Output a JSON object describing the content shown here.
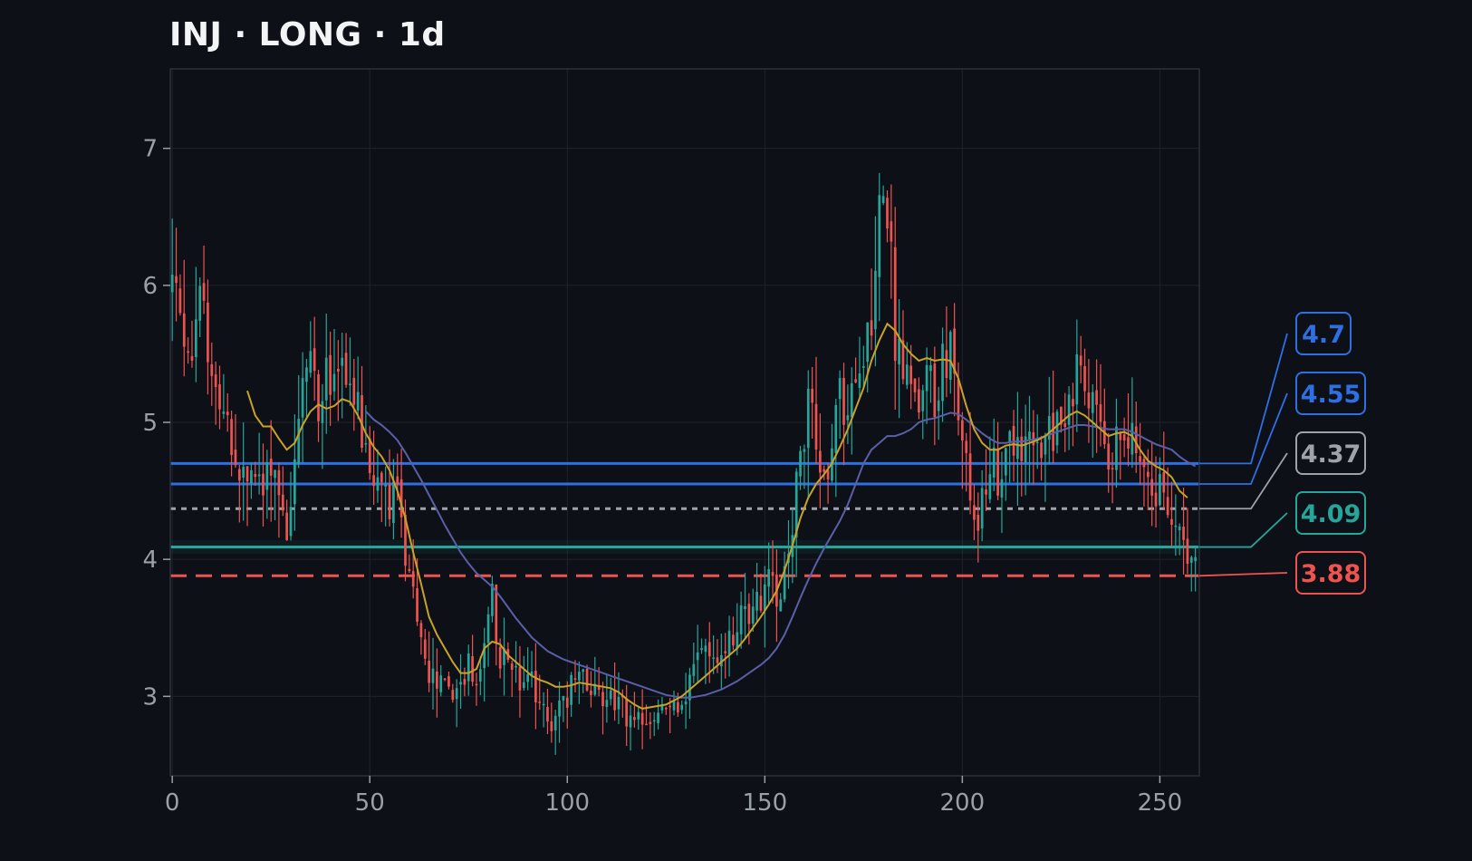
{
  "title": "INJ · LONG · 1d",
  "colors": {
    "background": "#0d1017",
    "plot_border": "#2c313a",
    "grid": "#1e232b",
    "tick_text": "#9aa0a8",
    "bull": "#26a69a",
    "bear": "#ef5350",
    "ma_fast": "#c9a227",
    "ma_slow": "#5a5fa8"
  },
  "chart_data": {
    "type": "candlestick",
    "title": "INJ · LONG · 1d",
    "xlabel": "",
    "ylabel": "",
    "xlim": [
      -0.5,
      260
    ],
    "ylim": [
      2.42,
      7.58
    ],
    "x_ticks": [
      0,
      50,
      100,
      150,
      200,
      250
    ],
    "y_ticks": [
      3,
      4,
      5,
      6,
      7
    ],
    "grid": true,
    "anchors": [
      [
        0,
        6.0
      ],
      [
        3,
        5.7
      ],
      [
        5,
        5.5
      ],
      [
        7,
        5.8
      ],
      [
        9,
        5.6
      ],
      [
        11,
        5.3
      ],
      [
        13,
        5.0
      ],
      [
        15,
        4.8
      ],
      [
        17,
        4.65
      ],
      [
        19,
        4.55
      ],
      [
        21,
        4.6
      ],
      [
        23,
        4.5
      ],
      [
        25,
        4.75
      ],
      [
        27,
        4.55
      ],
      [
        29,
        4.2
      ],
      [
        31,
        4.75
      ],
      [
        33,
        5.25
      ],
      [
        35,
        5.5
      ],
      [
        37,
        5.15
      ],
      [
        39,
        5.35
      ],
      [
        41,
        5.2
      ],
      [
        43,
        5.55
      ],
      [
        45,
        5.15
      ],
      [
        47,
        5.05
      ],
      [
        49,
        4.7
      ],
      [
        51,
        4.55
      ],
      [
        53,
        4.6
      ],
      [
        55,
        4.4
      ],
      [
        57,
        4.5
      ],
      [
        59,
        4.0
      ],
      [
        61,
        3.7
      ],
      [
        63,
        3.5
      ],
      [
        65,
        3.15
      ],
      [
        67,
        3.1
      ],
      [
        69,
        3.05
      ],
      [
        71,
        2.98
      ],
      [
        73,
        3.15
      ],
      [
        75,
        3.2
      ],
      [
        77,
        3.05
      ],
      [
        79,
        3.4
      ],
      [
        81,
        3.7
      ],
      [
        83,
        3.3
      ],
      [
        85,
        3.2
      ],
      [
        87,
        3.15
      ],
      [
        89,
        3.05
      ],
      [
        91,
        3.1
      ],
      [
        93,
        2.9
      ],
      [
        95,
        2.82
      ],
      [
        97,
        2.85
      ],
      [
        99,
        2.95
      ],
      [
        101,
        3.05
      ],
      [
        103,
        3.15
      ],
      [
        105,
        3.1
      ],
      [
        107,
        3.05
      ],
      [
        109,
        3.0
      ],
      [
        111,
        3.05
      ],
      [
        113,
        2.95
      ],
      [
        115,
        2.85
      ],
      [
        117,
        2.8
      ],
      [
        119,
        2.78
      ],
      [
        121,
        2.82
      ],
      [
        123,
        2.88
      ],
      [
        125,
        2.92
      ],
      [
        127,
        2.96
      ],
      [
        129,
        2.95
      ],
      [
        131,
        3.1
      ],
      [
        133,
        3.35
      ],
      [
        135,
        3.3
      ],
      [
        137,
        3.25
      ],
      [
        139,
        3.35
      ],
      [
        141,
        3.4
      ],
      [
        143,
        3.55
      ],
      [
        145,
        3.7
      ],
      [
        147,
        3.6
      ],
      [
        149,
        3.7
      ],
      [
        151,
        3.85
      ],
      [
        153,
        3.75
      ],
      [
        155,
        3.9
      ],
      [
        157,
        4.3
      ],
      [
        159,
        4.8
      ],
      [
        161,
        5.1
      ],
      [
        163,
        4.85
      ],
      [
        165,
        4.6
      ],
      [
        167,
        4.75
      ],
      [
        169,
        5.2
      ],
      [
        171,
        5.0
      ],
      [
        173,
        5.3
      ],
      [
        175,
        5.6
      ],
      [
        177,
        5.8
      ],
      [
        179,
        6.7
      ],
      [
        181,
        6.6
      ],
      [
        183,
        5.6
      ],
      [
        185,
        5.3
      ],
      [
        187,
        5.4
      ],
      [
        189,
        5.1
      ],
      [
        191,
        5.3
      ],
      [
        193,
        5.2
      ],
      [
        195,
        5.45
      ],
      [
        197,
        5.5
      ],
      [
        199,
        5.1
      ],
      [
        201,
        4.8
      ],
      [
        203,
        4.2
      ],
      [
        205,
        4.5
      ],
      [
        207,
        4.75
      ],
      [
        209,
        4.55
      ],
      [
        211,
        4.85
      ],
      [
        213,
        4.8
      ],
      [
        215,
        4.7
      ],
      [
        217,
        4.9
      ],
      [
        219,
        4.75
      ],
      [
        221,
        5.0
      ],
      [
        223,
        4.95
      ],
      [
        225,
        5.1
      ],
      [
        227,
        5.2
      ],
      [
        229,
        5.35
      ],
      [
        231,
        5.2
      ],
      [
        233,
        5.05
      ],
      [
        235,
        4.9
      ],
      [
        237,
        4.6
      ],
      [
        239,
        4.9
      ],
      [
        241,
        5.0
      ],
      [
        243,
        4.95
      ],
      [
        245,
        4.7
      ],
      [
        247,
        4.55
      ],
      [
        249,
        4.35
      ],
      [
        251,
        4.65
      ],
      [
        253,
        4.3
      ],
      [
        255,
        4.1
      ],
      [
        257,
        4.05
      ],
      [
        259,
        4.15
      ]
    ],
    "ma_fast": [
      [
        19,
        5.23
      ],
      [
        21,
        5.05
      ],
      [
        23,
        4.97
      ],
      [
        25,
        4.97
      ],
      [
        27,
        4.88
      ],
      [
        29,
        4.8
      ],
      [
        31,
        4.85
      ],
      [
        33,
        4.98
      ],
      [
        35,
        5.08
      ],
      [
        37,
        5.13
      ],
      [
        39,
        5.1
      ],
      [
        41,
        5.12
      ],
      [
        43,
        5.17
      ],
      [
        45,
        5.15
      ],
      [
        47,
        5.05
      ],
      [
        49,
        4.92
      ],
      [
        51,
        4.82
      ],
      [
        53,
        4.75
      ],
      [
        55,
        4.65
      ],
      [
        57,
        4.5
      ],
      [
        59,
        4.3
      ],
      [
        61,
        4.05
      ],
      [
        63,
        3.82
      ],
      [
        65,
        3.58
      ],
      [
        67,
        3.45
      ],
      [
        69,
        3.35
      ],
      [
        71,
        3.25
      ],
      [
        73,
        3.17
      ],
      [
        75,
        3.17
      ],
      [
        77,
        3.2
      ],
      [
        79,
        3.35
      ],
      [
        81,
        3.4
      ],
      [
        83,
        3.38
      ],
      [
        85,
        3.3
      ],
      [
        87,
        3.25
      ],
      [
        89,
        3.2
      ],
      [
        91,
        3.15
      ],
      [
        93,
        3.12
      ],
      [
        95,
        3.1
      ],
      [
        97,
        3.07
      ],
      [
        99,
        3.07
      ],
      [
        101,
        3.08
      ],
      [
        103,
        3.1
      ],
      [
        105,
        3.09
      ],
      [
        107,
        3.08
      ],
      [
        109,
        3.07
      ],
      [
        111,
        3.06
      ],
      [
        113,
        3.03
      ],
      [
        115,
        2.98
      ],
      [
        117,
        2.94
      ],
      [
        119,
        2.91
      ],
      [
        121,
        2.92
      ],
      [
        123,
        2.93
      ],
      [
        125,
        2.94
      ],
      [
        127,
        2.97
      ],
      [
        129,
        3.0
      ],
      [
        131,
        3.05
      ],
      [
        133,
        3.1
      ],
      [
        135,
        3.15
      ],
      [
        137,
        3.2
      ],
      [
        139,
        3.25
      ],
      [
        141,
        3.3
      ],
      [
        143,
        3.35
      ],
      [
        145,
        3.42
      ],
      [
        147,
        3.5
      ],
      [
        149,
        3.58
      ],
      [
        151,
        3.67
      ],
      [
        153,
        3.77
      ],
      [
        155,
        3.92
      ],
      [
        157,
        4.1
      ],
      [
        159,
        4.3
      ],
      [
        161,
        4.45
      ],
      [
        163,
        4.55
      ],
      [
        165,
        4.62
      ],
      [
        167,
        4.7
      ],
      [
        169,
        4.82
      ],
      [
        171,
        4.95
      ],
      [
        173,
        5.1
      ],
      [
        175,
        5.25
      ],
      [
        177,
        5.45
      ],
      [
        179,
        5.6
      ],
      [
        181,
        5.72
      ],
      [
        183,
        5.67
      ],
      [
        185,
        5.57
      ],
      [
        187,
        5.5
      ],
      [
        189,
        5.45
      ],
      [
        191,
        5.47
      ],
      [
        193,
        5.45
      ],
      [
        195,
        5.46
      ],
      [
        197,
        5.45
      ],
      [
        199,
        5.32
      ],
      [
        201,
        5.12
      ],
      [
        203,
        4.95
      ],
      [
        205,
        4.85
      ],
      [
        207,
        4.8
      ],
      [
        209,
        4.8
      ],
      [
        211,
        4.83
      ],
      [
        213,
        4.84
      ],
      [
        215,
        4.83
      ],
      [
        217,
        4.85
      ],
      [
        219,
        4.87
      ],
      [
        221,
        4.9
      ],
      [
        223,
        4.95
      ],
      [
        225,
        5.0
      ],
      [
        227,
        5.05
      ],
      [
        229,
        5.08
      ],
      [
        231,
        5.05
      ],
      [
        233,
        5.0
      ],
      [
        235,
        4.95
      ],
      [
        237,
        4.9
      ],
      [
        239,
        4.92
      ],
      [
        241,
        4.93
      ],
      [
        243,
        4.9
      ],
      [
        245,
        4.8
      ],
      [
        247,
        4.72
      ],
      [
        249,
        4.68
      ],
      [
        251,
        4.65
      ],
      [
        253,
        4.6
      ],
      [
        255,
        4.5
      ],
      [
        257,
        4.45
      ]
    ],
    "ma_slow": [
      [
        49,
        5.08
      ],
      [
        51,
        5.02
      ],
      [
        53,
        4.98
      ],
      [
        55,
        4.93
      ],
      [
        57,
        4.87
      ],
      [
        59,
        4.78
      ],
      [
        61,
        4.68
      ],
      [
        63,
        4.58
      ],
      [
        65,
        4.47
      ],
      [
        67,
        4.36
      ],
      [
        69,
        4.25
      ],
      [
        71,
        4.15
      ],
      [
        73,
        4.05
      ],
      [
        75,
        3.97
      ],
      [
        77,
        3.9
      ],
      [
        79,
        3.85
      ],
      [
        81,
        3.8
      ],
      [
        83,
        3.73
      ],
      [
        85,
        3.65
      ],
      [
        87,
        3.57
      ],
      [
        89,
        3.5
      ],
      [
        91,
        3.43
      ],
      [
        93,
        3.38
      ],
      [
        95,
        3.33
      ],
      [
        97,
        3.3
      ],
      [
        99,
        3.27
      ],
      [
        101,
        3.25
      ],
      [
        103,
        3.23
      ],
      [
        105,
        3.21
      ],
      [
        107,
        3.19
      ],
      [
        109,
        3.17
      ],
      [
        111,
        3.15
      ],
      [
        113,
        3.13
      ],
      [
        115,
        3.11
      ],
      [
        117,
        3.09
      ],
      [
        119,
        3.07
      ],
      [
        121,
        3.05
      ],
      [
        123,
        3.03
      ],
      [
        125,
        3.01
      ],
      [
        127,
        3.0
      ],
      [
        129,
        2.99
      ],
      [
        131,
        2.99
      ],
      [
        133,
        3.0
      ],
      [
        135,
        3.01
      ],
      [
        137,
        3.03
      ],
      [
        139,
        3.05
      ],
      [
        141,
        3.08
      ],
      [
        143,
        3.11
      ],
      [
        145,
        3.15
      ],
      [
        147,
        3.19
      ],
      [
        149,
        3.23
      ],
      [
        151,
        3.28
      ],
      [
        153,
        3.35
      ],
      [
        155,
        3.45
      ],
      [
        157,
        3.58
      ],
      [
        159,
        3.72
      ],
      [
        161,
        3.85
      ],
      [
        163,
        3.97
      ],
      [
        165,
        4.08
      ],
      [
        167,
        4.18
      ],
      [
        169,
        4.28
      ],
      [
        171,
        4.4
      ],
      [
        173,
        4.55
      ],
      [
        175,
        4.7
      ],
      [
        177,
        4.8
      ],
      [
        179,
        4.85
      ],
      [
        181,
        4.9
      ],
      [
        183,
        4.9
      ],
      [
        185,
        4.92
      ],
      [
        187,
        4.95
      ],
      [
        189,
        5.0
      ],
      [
        191,
        5.02
      ],
      [
        193,
        5.03
      ],
      [
        195,
        5.05
      ],
      [
        197,
        5.07
      ],
      [
        199,
        5.06
      ],
      [
        201,
        5.02
      ],
      [
        203,
        4.97
      ],
      [
        205,
        4.92
      ],
      [
        207,
        4.88
      ],
      [
        209,
        4.85
      ],
      [
        211,
        4.85
      ],
      [
        213,
        4.86
      ],
      [
        215,
        4.86
      ],
      [
        217,
        4.87
      ],
      [
        219,
        4.88
      ],
      [
        221,
        4.9
      ],
      [
        223,
        4.92
      ],
      [
        225,
        4.94
      ],
      [
        227,
        4.96
      ],
      [
        229,
        4.98
      ],
      [
        231,
        4.98
      ],
      [
        233,
        4.97
      ],
      [
        235,
        4.96
      ],
      [
        237,
        4.95
      ],
      [
        239,
        4.95
      ],
      [
        241,
        4.95
      ],
      [
        243,
        4.93
      ],
      [
        245,
        4.9
      ],
      [
        247,
        4.87
      ],
      [
        249,
        4.84
      ],
      [
        251,
        4.82
      ],
      [
        253,
        4.8
      ],
      [
        255,
        4.75
      ],
      [
        257,
        4.71
      ],
      [
        259,
        4.68
      ]
    ],
    "levels": [
      {
        "value": 4.7,
        "label": "4.7",
        "color": "#2f6fe4",
        "style": "solid"
      },
      {
        "value": 4.55,
        "label": "4.55",
        "color": "#2f6fe4",
        "style": "solid"
      },
      {
        "value": 4.37,
        "label": "4.37",
        "color": "#9ea3ab",
        "style": "dotted"
      },
      {
        "value": 4.09,
        "label": "4.09",
        "color": "#26a69a",
        "style": "solid"
      },
      {
        "value": 3.88,
        "label": "3.88",
        "color": "#ef5350",
        "style": "dashed"
      }
    ]
  }
}
